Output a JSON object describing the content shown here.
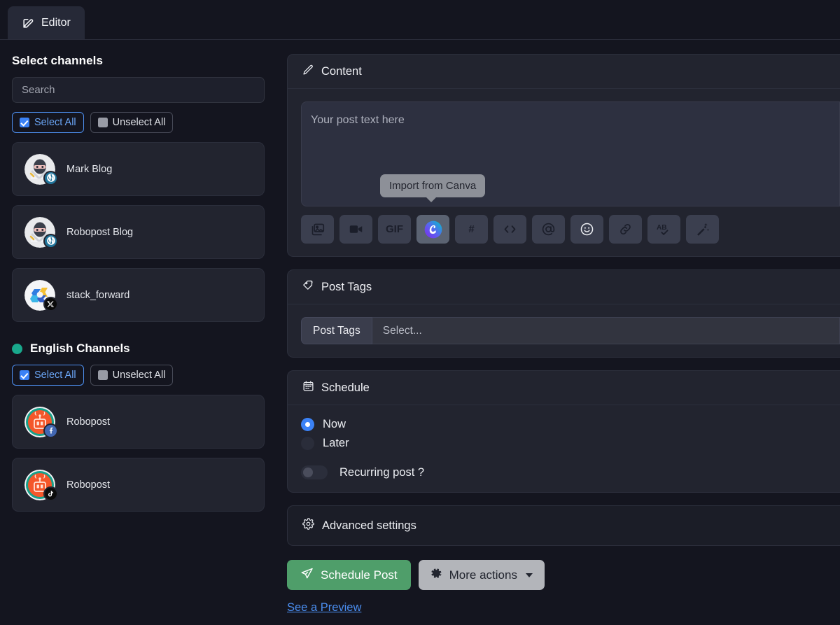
{
  "tab": {
    "label": "Editor",
    "icon": "edit-square-icon"
  },
  "sidebar": {
    "title": "Select channels",
    "search": {
      "placeholder": "Search",
      "value": ""
    },
    "select_all_label": "Select All",
    "unselect_all_label": "Unselect All",
    "channels": [
      {
        "name": "Mark Blog",
        "avatar": "ninja-avatar",
        "badge": "wordpress-badge"
      },
      {
        "name": "Robopost Blog",
        "avatar": "ninja-avatar",
        "badge": "wordpress-badge"
      },
      {
        "name": "stack_forward",
        "avatar": "stack-forward-avatar",
        "badge": "x-badge"
      }
    ],
    "group": {
      "label": "English Channels",
      "dot_color": "#19a88c",
      "select_all_label": "Select All",
      "unselect_all_label": "Unselect All",
      "channels": [
        {
          "name": "Robopost",
          "avatar": "robopost-avatar",
          "badge": "facebook-badge"
        },
        {
          "name": "Robopost",
          "avatar": "robopost-avatar",
          "badge": "tiktok-badge"
        }
      ]
    }
  },
  "content": {
    "title": "Content",
    "editor_placeholder": "Your post text here",
    "tooltip": "Import from Canva",
    "toolbar": [
      {
        "name": "image-icon",
        "label": ""
      },
      {
        "name": "video-icon",
        "label": ""
      },
      {
        "name": "gif-icon",
        "label": "GIF"
      },
      {
        "name": "canva-icon",
        "label": "",
        "active": true
      },
      {
        "name": "hashtag-icon",
        "label": "#"
      },
      {
        "name": "code-icon",
        "label": ""
      },
      {
        "name": "mention-icon",
        "label": ""
      },
      {
        "name": "emoji-icon",
        "label": ""
      },
      {
        "name": "link-icon",
        "label": ""
      },
      {
        "name": "spellcheck-icon",
        "label": ""
      },
      {
        "name": "magic-wand-icon",
        "label": ""
      }
    ]
  },
  "post_tags": {
    "title": "Post Tags",
    "field_label": "Post Tags",
    "select_placeholder": "Select..."
  },
  "schedule": {
    "title": "Schedule",
    "options": [
      {
        "label": "Now",
        "selected": true
      },
      {
        "label": "Later",
        "selected": false
      }
    ],
    "recurring_label": "Recurring post ?",
    "recurring_on": false
  },
  "advanced": {
    "label": "Advanced settings"
  },
  "actions": {
    "primary_label": "Schedule Post",
    "secondary_label": "More actions",
    "preview_label": "See a Preview",
    "primary_color": "#4f9e6a"
  }
}
